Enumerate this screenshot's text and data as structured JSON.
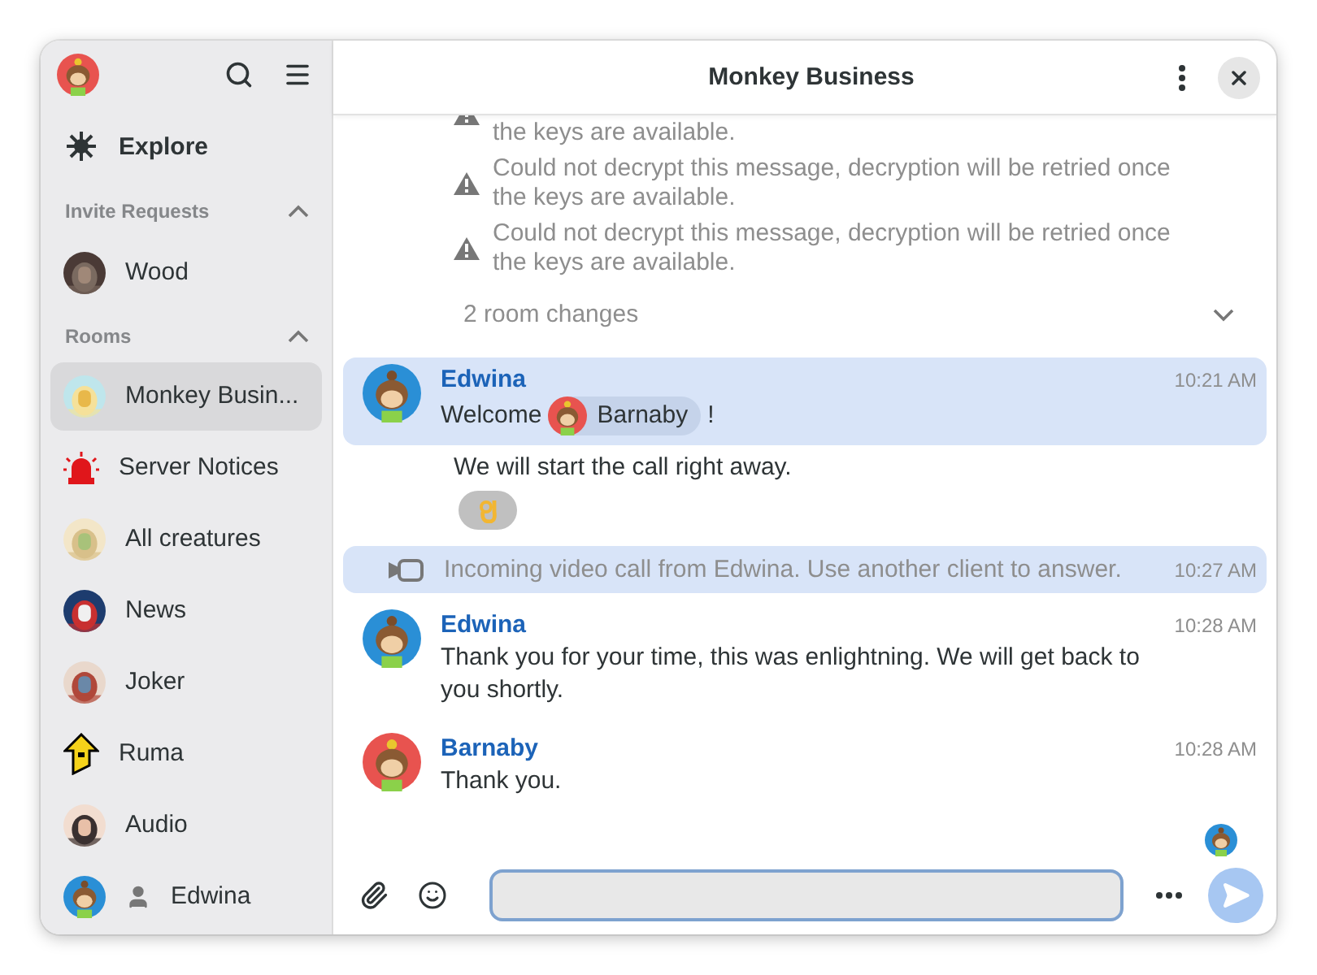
{
  "sidebar": {
    "explore": {
      "label": "Explore"
    },
    "sections": [
      {
        "title": "Invite Requests",
        "expanded": true,
        "rooms": [
          {
            "name": "Wood",
            "kind": "picture",
            "selected": false
          }
        ]
      },
      {
        "title": "Rooms",
        "expanded": true,
        "rooms": [
          {
            "name": "Monkey Busin...",
            "kind": "picture",
            "selected": true
          },
          {
            "name": "Server Notices",
            "kind": "siren",
            "selected": false
          },
          {
            "name": "All creatures",
            "kind": "picture",
            "selected": false
          },
          {
            "name": "News",
            "kind": "picture",
            "selected": false
          },
          {
            "name": "Joker",
            "kind": "picture",
            "selected": false
          },
          {
            "name": "Ruma",
            "kind": "house",
            "selected": false
          },
          {
            "name": "Audio",
            "kind": "picture",
            "selected": false
          },
          {
            "name": "Edwina",
            "kind": "user",
            "color": "#2a8fd6",
            "selected": false
          }
        ]
      }
    ]
  },
  "room": {
    "title": "Monkey Business"
  },
  "timeline": [
    {
      "kind": "undecryptable",
      "text": "the keys are available.",
      "partial": true
    },
    {
      "kind": "undecryptable",
      "text": "Could not decrypt this message, decryption will be retried once the keys are available.",
      "partial": false
    },
    {
      "kind": "undecryptable",
      "text": "Could not decrypt this message, decryption will be retried once the keys are available.",
      "partial": false
    },
    {
      "kind": "room_changes",
      "text": "2 room changes",
      "expanded": false
    },
    {
      "kind": "message",
      "sender": "Edwina",
      "color": "#2a8fd6",
      "time": "10:21 AM",
      "highlighted": true,
      "parts": [
        {
          "kind": "text",
          "text": "Welcome"
        },
        {
          "kind": "mention",
          "text": "Barnaby",
          "color": "#e8534f"
        },
        {
          "kind": "text",
          "text": "!"
        }
      ]
    },
    {
      "kind": "continuation",
      "text": "We will start the call right away.",
      "reactions": [
        {
          "kind": "ok_hand"
        }
      ]
    },
    {
      "kind": "call",
      "text": "Incoming video call from Edwina. Use another client to answer.",
      "time": "10:27 AM",
      "highlighted": true
    },
    {
      "kind": "message",
      "sender": "Edwina",
      "color": "#2a8fd6",
      "time": "10:28 AM",
      "highlighted": false,
      "parts": [
        {
          "kind": "text",
          "text": "Thank you for your time, this was enlightning. We will get back to you shortly."
        }
      ]
    },
    {
      "kind": "message",
      "sender": "Barnaby",
      "color": "#e8534f",
      "time": "10:28 AM",
      "highlighted": false,
      "parts": [
        {
          "kind": "text",
          "text": "Thank you."
        }
      ]
    },
    {
      "kind": "read_receipt",
      "color": "#2a8fd6"
    }
  ]
}
